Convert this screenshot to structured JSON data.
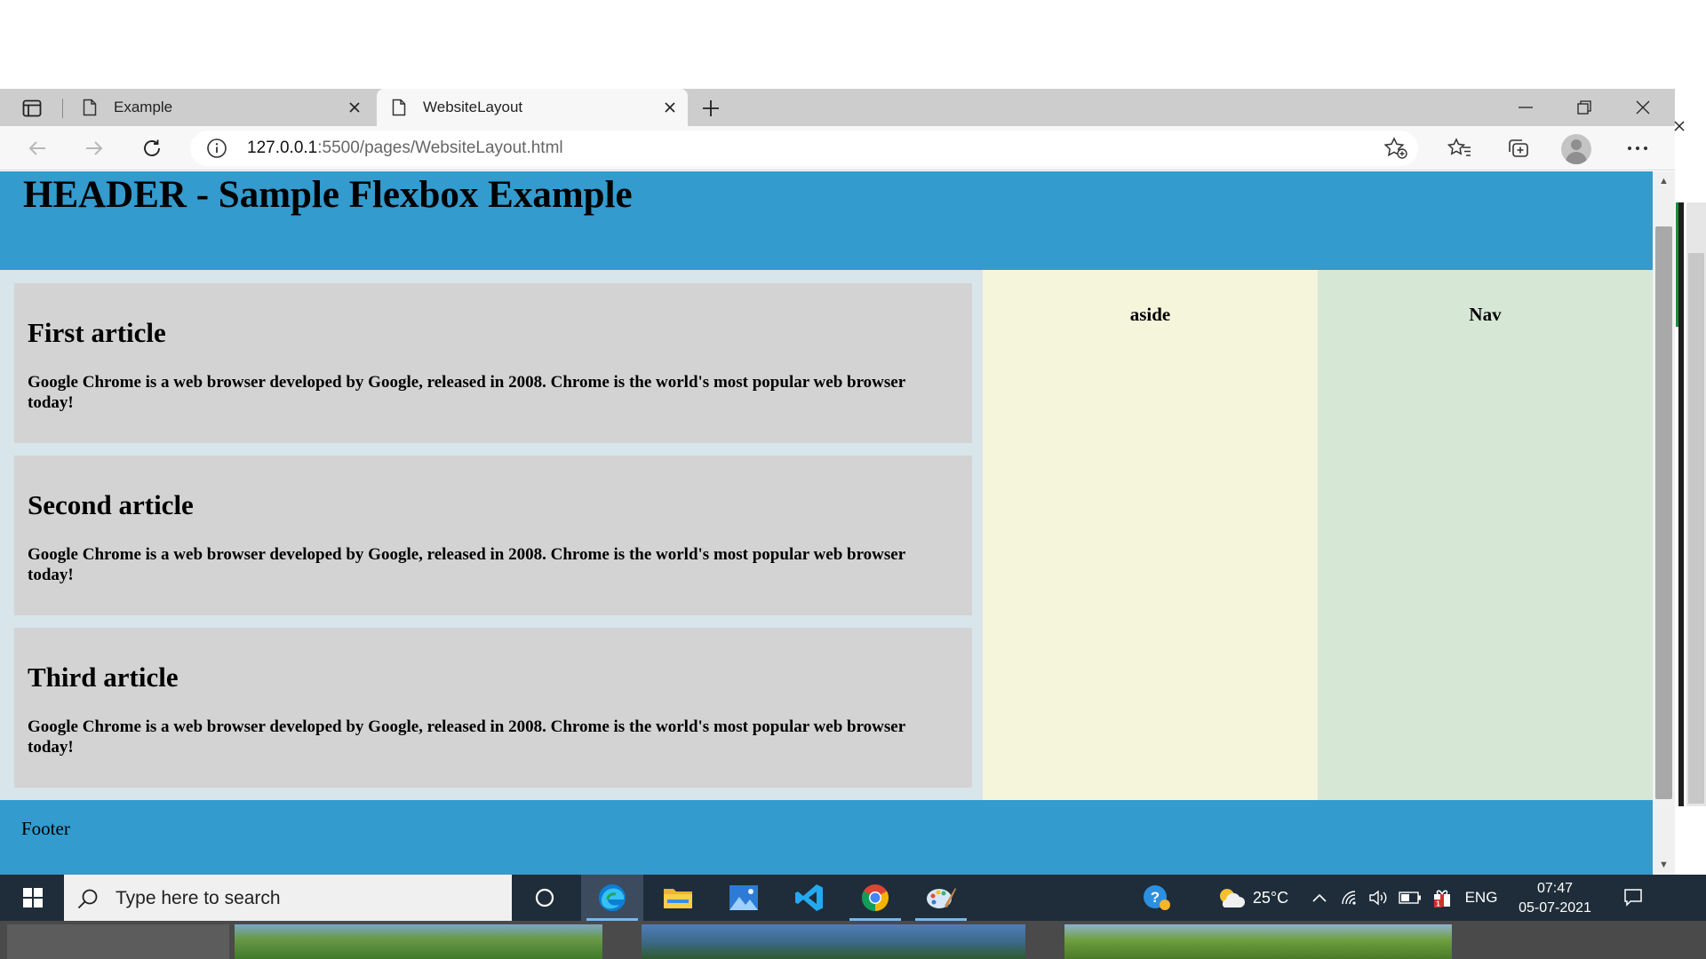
{
  "browser": {
    "tabs": [
      {
        "label": "Example",
        "active": false
      },
      {
        "label": "WebsiteLayout",
        "active": true
      }
    ],
    "address": {
      "host": "127.0.0.1",
      "rest": ":5500/pages/WebsiteLayout.html"
    },
    "icons": {
      "tab_actions": "tab-actions-icon",
      "page": "page-icon",
      "close": "close-icon",
      "new_tab": "plus-icon",
      "minimize": "minimize-icon",
      "restore": "restore-icon",
      "back": "back-arrow-icon",
      "forward": "forward-arrow-icon",
      "refresh": "refresh-icon",
      "info": "info-icon",
      "favorite_add": "star-plus-icon",
      "favorites": "favorites-icon",
      "collections": "collections-icon",
      "profile": "profile-icon",
      "more": "more-icon"
    }
  },
  "page": {
    "header_title": "HEADER - Sample Flexbox Example",
    "articles": [
      {
        "title": "First article",
        "body": "Google Chrome is a web browser developed by Google, released in 2008. Chrome is the world's most popular web browser today!"
      },
      {
        "title": "Second article",
        "body": "Google Chrome is a web browser developed by Google, released in 2008. Chrome is the world's most popular web browser today!"
      },
      {
        "title": "Third article",
        "body": "Google Chrome is a web browser developed by Google, released in 2008. Chrome is the world's most popular web browser today!"
      }
    ],
    "aside_label": "aside",
    "nav_label": "Nav",
    "footer_label": "Footer",
    "colors": {
      "header": "#339bcd",
      "articles_bg": "#d8e5ea",
      "article": "#d3d3d3",
      "aside": "#f5f5dc",
      "nav": "#d6e7d6",
      "footer": "#339bcd"
    }
  },
  "taskbar": {
    "search_placeholder": "Type here to search",
    "weather": "25°C",
    "language": "ENG",
    "time": "07:47",
    "date": "05-07-2021",
    "apps": [
      "cortana-icon",
      "edge-icon",
      "file-explorer-icon",
      "photos-icon",
      "vscode-icon",
      "chrome-icon",
      "paint-icon"
    ]
  }
}
